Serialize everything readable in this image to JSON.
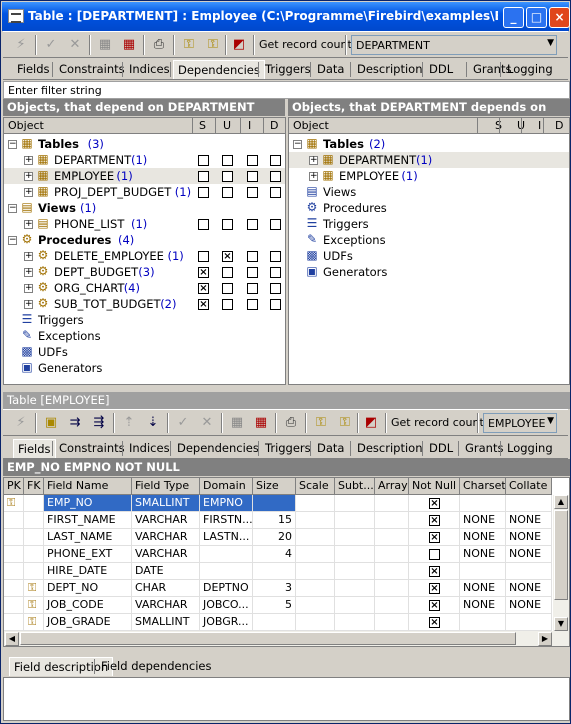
{
  "window": {
    "title": "Table : [DEPARTMENT] : Employee (C:\\Programme\\Firebird\\examples\\EMP...",
    "min": "_",
    "max": "□",
    "close": "×"
  },
  "toolbar1": {
    "get_record_count": "Get record count",
    "table_combo": "DEPARTMENT"
  },
  "tabs1": [
    "Fields",
    "Constraints",
    "Indices",
    "Dependencies",
    "Triggers",
    "Data",
    "Description",
    "DDL",
    "Grants",
    "Logging"
  ],
  "filter": {
    "placeholder": "Enter filter string"
  },
  "left_pane": {
    "title": "Objects, that depend on DEPARTMENT",
    "col_object": "Object",
    "col_s": "S",
    "col_u": "U",
    "col_i": "I",
    "col_d": "D",
    "groups": [
      {
        "label": "Tables",
        "count": "(3)",
        "items": [
          {
            "label": "DEPARTMENT",
            "count": "(1)",
            "s": false,
            "u": false,
            "i": false,
            "d": false
          },
          {
            "label": "EMPLOYEE",
            "count": "(1)",
            "s": false,
            "u": false,
            "i": false,
            "d": false
          },
          {
            "label": "PROJ_DEPT_BUDGET",
            "count": "(1)",
            "s": false,
            "u": false,
            "i": false,
            "d": false
          }
        ]
      },
      {
        "label": "Views",
        "count": "(1)",
        "items": [
          {
            "label": "PHONE_LIST",
            "count": "(1)",
            "s": false,
            "u": false,
            "i": false,
            "d": false
          }
        ]
      },
      {
        "label": "Procedures",
        "count": "(4)",
        "items": [
          {
            "label": "DELETE_EMPLOYEE",
            "count": "(1)",
            "s": false,
            "u": true,
            "i": false,
            "d": false
          },
          {
            "label": "DEPT_BUDGET",
            "count": "(3)",
            "s": true,
            "u": false,
            "i": false,
            "d": false
          },
          {
            "label": "ORG_CHART",
            "count": "(4)",
            "s": true,
            "u": false,
            "i": false,
            "d": false
          },
          {
            "label": "SUB_TOT_BUDGET",
            "count": "(2)",
            "s": true,
            "u": false,
            "i": false,
            "d": false
          }
        ]
      }
    ],
    "extra": [
      "Triggers",
      "Exceptions",
      "UDFs",
      "Generators"
    ]
  },
  "right_pane": {
    "title": "Objects, that DEPARTMENT depends on",
    "col_object": "Object",
    "col_s": "S",
    "col_u": "U",
    "col_i": "I",
    "col_d": "D",
    "group": {
      "label": "Tables",
      "count": "(2)",
      "items": [
        {
          "label": "DEPARTMENT",
          "count": "(1)"
        },
        {
          "label": "EMPLOYEE",
          "count": "(1)"
        }
      ]
    },
    "extra": [
      "Views",
      "Procedures",
      "Triggers",
      "Exceptions",
      "UDFs",
      "Generators"
    ]
  },
  "table_bar": {
    "title": "Table [EMPLOYEE]"
  },
  "toolbar2": {
    "get_record_count": "Get record count",
    "table_combo": "EMPLOYEE"
  },
  "tabs2": [
    "Fields",
    "Constraints",
    "Indices",
    "Dependencies",
    "Triggers",
    "Data",
    "Description",
    "DDL",
    "Grants",
    "Logging"
  ],
  "field_header": "EMP_NO EMPNO NOT NULL",
  "grid": {
    "columns": [
      "PK",
      "FK",
      "Field Name",
      "Field Type",
      "Domain",
      "Size",
      "Scale",
      "Subt...",
      "Array",
      "Not Null",
      "Charset",
      "Collate"
    ],
    "rows": [
      {
        "pk": true,
        "fk": false,
        "name": "EMP_NO",
        "type": "SMALLINT",
        "domain": "EMPNO",
        "size": "",
        "notnull": true,
        "charset": "",
        "collate": ""
      },
      {
        "pk": false,
        "fk": false,
        "name": "FIRST_NAME",
        "type": "VARCHAR",
        "domain": "FIRSTN...",
        "size": "15",
        "notnull": true,
        "charset": "NONE",
        "collate": "NONE"
      },
      {
        "pk": false,
        "fk": false,
        "name": "LAST_NAME",
        "type": "VARCHAR",
        "domain": "LASTN...",
        "size": "20",
        "notnull": true,
        "charset": "NONE",
        "collate": "NONE"
      },
      {
        "pk": false,
        "fk": false,
        "name": "PHONE_EXT",
        "type": "VARCHAR",
        "domain": "",
        "size": "4",
        "notnull": false,
        "charset": "NONE",
        "collate": "NONE"
      },
      {
        "pk": false,
        "fk": false,
        "name": "HIRE_DATE",
        "type": "DATE",
        "domain": "",
        "size": "",
        "notnull": true,
        "charset": "",
        "collate": ""
      },
      {
        "pk": false,
        "fk": true,
        "name": "DEPT_NO",
        "type": "CHAR",
        "domain": "DEPTNO",
        "size": "3",
        "notnull": true,
        "charset": "NONE",
        "collate": "NONE"
      },
      {
        "pk": false,
        "fk": true,
        "name": "JOB_CODE",
        "type": "VARCHAR",
        "domain": "JOBCO...",
        "size": "5",
        "notnull": true,
        "charset": "NONE",
        "collate": "NONE"
      },
      {
        "pk": false,
        "fk": true,
        "name": "JOB_GRADE",
        "type": "SMALLINT",
        "domain": "JOBGR...",
        "size": "",
        "notnull": true,
        "charset": "",
        "collate": ""
      }
    ]
  },
  "bottom_tabs": [
    "Field description",
    "Field dependencies"
  ],
  "colors": {
    "title": "#0054e3",
    "selection": "#316ac5",
    "count": "#0000c0"
  }
}
